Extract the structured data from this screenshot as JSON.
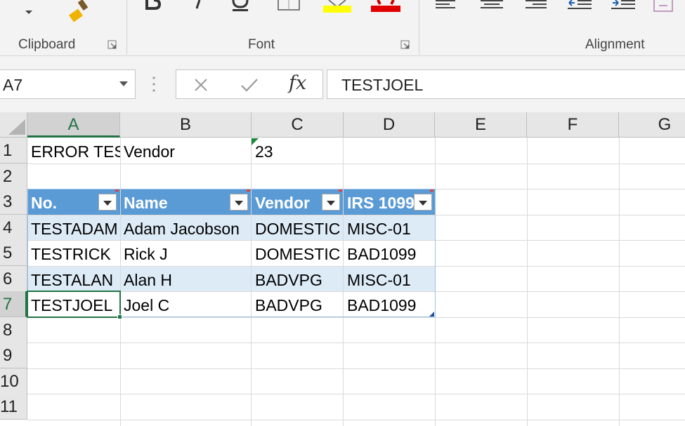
{
  "ribbon": {
    "groups": [
      {
        "label": "Clipboard"
      },
      {
        "label": "Font"
      },
      {
        "label": "Alignment"
      }
    ],
    "font_colors": {
      "highlight": "#ffff00",
      "font_color": "#ff0000"
    }
  },
  "formula_bar": {
    "name_box": "A7",
    "fx_label": "fx",
    "content": "TESTJOEL"
  },
  "grid": {
    "columns": [
      "A",
      "B",
      "C",
      "D",
      "E",
      "F",
      "G"
    ],
    "rows": [
      "1",
      "2",
      "3",
      "4",
      "5",
      "6",
      "7",
      "8",
      "9",
      "10",
      "11"
    ],
    "row1": {
      "a": "ERROR TEST",
      "b": "Vendor",
      "c": "23"
    },
    "table": {
      "headers": [
        "No.",
        "Name",
        "Vendor",
        "IRS 1099"
      ],
      "rows": [
        [
          "TESTADAM",
          "Adam Jacobson",
          "DOMESTIC",
          "MISC-01"
        ],
        [
          "TESTRICK",
          "Rick J",
          "DOMESTIC",
          "BAD1099"
        ],
        [
          "TESTALAN",
          "Alan H",
          "BADVPG",
          "MISC-01"
        ],
        [
          "TESTJOEL",
          "Joel C",
          "BADVPG",
          "BAD1099"
        ]
      ]
    },
    "active_cell": "A7"
  },
  "colors": {
    "excel_green": "#217346",
    "table_header": "#5b9bd5",
    "table_band": "#ddebf7"
  }
}
